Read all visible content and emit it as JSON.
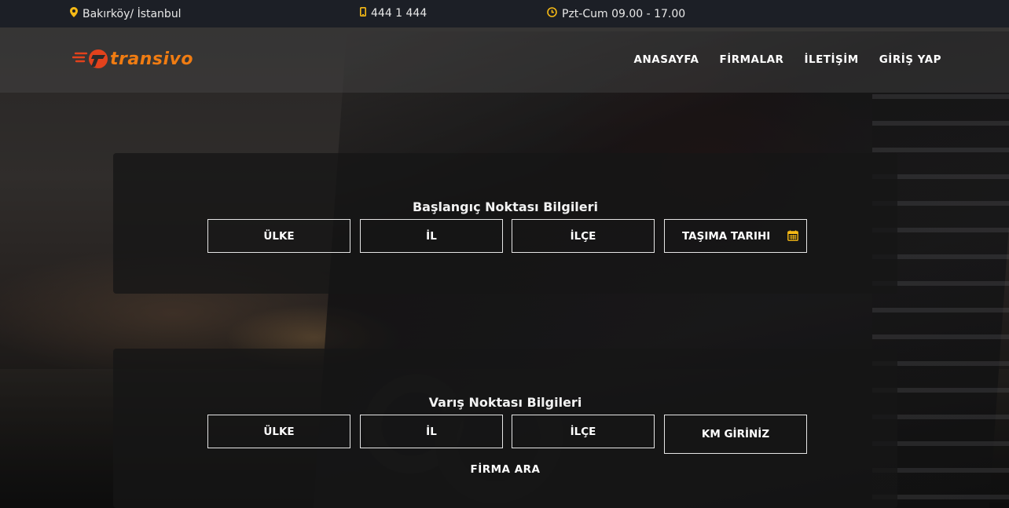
{
  "topbar": {
    "location": "Bakırköy/ İstanbul",
    "phone": "444 1 444",
    "hours": "Pzt-Cum 09.00 - 17.00",
    "location_icon": "map-marker-icon",
    "phone_icon": "mobile-phone-icon",
    "hours_icon": "clock-icon",
    "icon_color": "#f5b915"
  },
  "brand": {
    "name": "transivo",
    "color": "#f07c12",
    "accent": "#e2421c"
  },
  "nav": {
    "items": [
      "ANASAYFA",
      "FİRMALAR",
      "İLETİŞİM",
      "GİRİŞ YAP"
    ]
  },
  "start_section": {
    "title": "Başlangıç Noktası Bilgileri",
    "country": "ÜLKE",
    "city": "İL",
    "district": "İLÇE",
    "date": "TAŞIMA TARIHI",
    "date_icon": "calendar-icon"
  },
  "end_section": {
    "title": "Varış Noktası Bilgileri",
    "country": "ÜLKE",
    "city": "İL",
    "district": "İLÇE",
    "km": "KM GİRİNİZ",
    "search_button": "FİRMA ARA"
  }
}
